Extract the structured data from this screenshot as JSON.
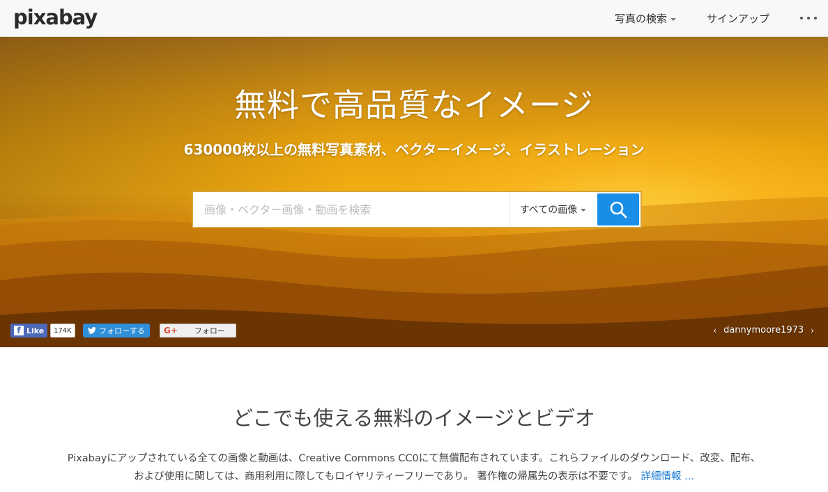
{
  "header": {
    "logo": "pixabay",
    "nav_search": "写真の検索",
    "nav_signup": "サインアップ",
    "more_icon": "ellipsis-icon"
  },
  "hero": {
    "title": "無料で高品質なイメージ",
    "subtitle": "630000枚以上の無料写真素材、ベクターイメージ、イラストレーション",
    "search": {
      "placeholder": "画像・ベクター画像・動画を検索",
      "type_label": "すべての画像"
    },
    "social": {
      "fb_like": "Like",
      "fb_count": "174K",
      "twitter_follow": "フォローする",
      "gplus_follow": "フォロー"
    },
    "credit": "dannymoore1973"
  },
  "content": {
    "heading": "どこでも使える無料のイメージとビデオ",
    "description": "Pixabayにアップされている全ての画像と動画は、Creative Commons CC0にて無償配布されています。これらファイルのダウンロード、改変、配布、および使用に関しては、商用利用に際してもロイヤリティーフリーであり。 著作権の帰属先の表示は不要です。",
    "more_link": "詳細情報 ..."
  },
  "colors": {
    "accent": "#1a8ee6",
    "link": "#1a7bd6",
    "facebook": "#4c69ba",
    "twitter": "#2f8fd8"
  }
}
